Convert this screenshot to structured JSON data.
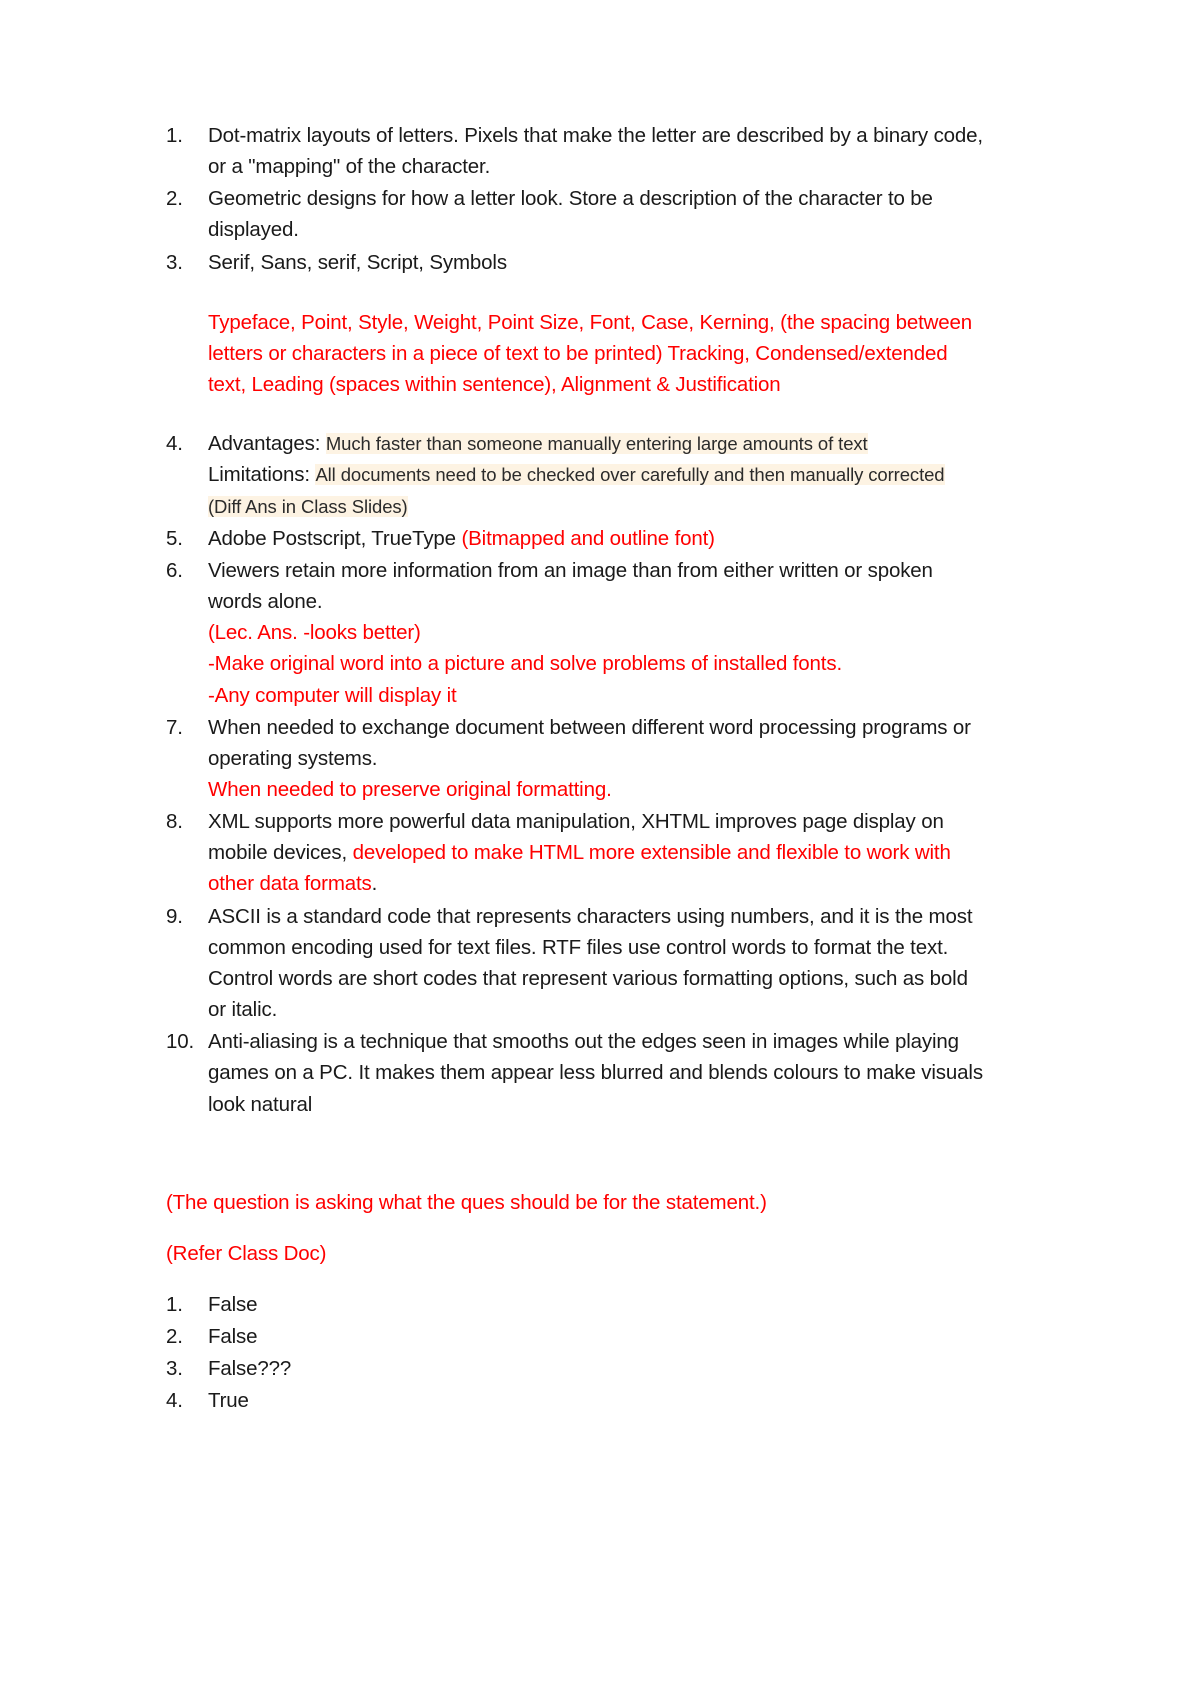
{
  "document": {
    "page_background": "#ffffff",
    "text_color": "#1a1a1a",
    "accent_color": "#ff0000",
    "highlight_color": "#fdf3e3",
    "main_list": [
      {
        "number": "1.",
        "segments": [
          {
            "text": "Dot-matrix layouts of letters. Pixels that make the letter are described by a binary code, or a \"mapping\" of the character.",
            "style": "black"
          }
        ]
      },
      {
        "number": "2.",
        "segments": [
          {
            "text": "Geometric designs for how a letter look. Store a description of the character to be displayed.",
            "style": "black"
          }
        ]
      },
      {
        "number": "3.",
        "segments": [
          {
            "text": "Serif, Sans, serif, Script, Symbols",
            "style": "black"
          }
        ]
      }
    ],
    "red_block_after_3": "Typeface, Point, Style, Weight, Point Size, Font, Case, Kerning, (the spacing between letters or characters in a piece of text to be printed) Tracking, Condensed/extended text, Leading (spaces within sentence), Alignment & Justification",
    "item4": {
      "number": "4.",
      "advantages_label": "Advantages:",
      "advantages_text": "Much faster than someone manually entering large amounts of text",
      "limitations_label": "Limitations:",
      "limitations_text": "All documents need to be checked over carefully and then manually corrected",
      "note_text": "(Diff Ans in Class Slides)"
    },
    "item5": {
      "number": "5.",
      "black_text": "Adobe Postscript, TrueType ",
      "red_text": "(Bitmapped and outline font)"
    },
    "item6": {
      "number": "6.",
      "black_text": "Viewers retain more information from an image than from either written or spoken words alone.",
      "red_lines": [
        "(Lec. Ans. -looks better)",
        "-Make original word into a picture and solve problems of installed fonts.",
        "-Any computer will display it"
      ]
    },
    "item7": {
      "number": "7.",
      "black_text": "When needed to exchange document between different word processing programs or operating systems.",
      "red_text": "When needed to preserve original formatting."
    },
    "item8": {
      "number": "8.",
      "black_text_1": "XML supports more powerful data manipulation, XHTML improves page display on mobile devices, ",
      "red_text": "developed to make HTML more extensible and flexible to work with other data formats",
      "black_text_2": "."
    },
    "item9": {
      "number": "9.",
      "text": "ASCII is a standard code that represents characters using numbers, and it is the most common encoding used for text files. RTF files use control words to format the text. Control words are short codes that represent various formatting options, such as bold or italic."
    },
    "item10": {
      "number": "10.",
      "text": "Anti-aliasing is a technique that smooths out the edges seen in images while playing games on a PC. It makes them appear less blurred and blends colours to make visuals look natural"
    },
    "note_question": "(The question is asking what the ques should be for the statement.)",
    "note_refer": "(Refer Class Doc)",
    "answers": [
      {
        "number": "1.",
        "value": "False"
      },
      {
        "number": "2.",
        "value": "False"
      },
      {
        "number": "3.",
        "value": "False???"
      },
      {
        "number": "4.",
        "value": "True"
      }
    ]
  }
}
